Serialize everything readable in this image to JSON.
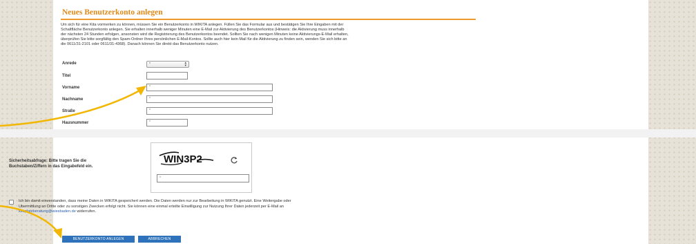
{
  "form": {
    "title": "Neues Benutzerkonto anlegen",
    "intro_lines": [
      "Um sich für eine Kita vormerken zu können, müssen Sie ein Benutzerkonto in WIKITA anlegen. Füllen Sie das Formular aus und bestätigen Sie Ihre Eingaben mit der",
      "Schaltfläche Benutzerkonto anlegen. Sie erhalten innerhalb weniger Minuten eine E-Mail zur Aktivierung des Benutzerkontos (Hinweis: die Aktivierung muss innerhalb",
      "der nächsten 24 Stunden erfolgen, ansonsten wird die Registrierung des Benutzerkontos beendet. Sollten Sie nach wenigen Minuten keine Aktivierungs-E-Mail erhalten,",
      "überprüfen Sie bitte sorgfältig den Spam-Ordner Ihres persönlichen E-Mail-Kontos. Sollte auch hier kein Mail für die Aktivierung zu finden sein, wenden Sie sich bitte an",
      "die 0611/31-2101 oder 0611/31-4368). Danach können Sie direkt das Benutzerkonto nutzen."
    ],
    "fields": {
      "anrede": {
        "label": "Anrede",
        "value": "*"
      },
      "titel": {
        "label": "Titel",
        "value": ""
      },
      "vorname": {
        "label": "Vorname",
        "value": "*"
      },
      "nachname": {
        "label": "Nachname",
        "value": "*"
      },
      "strasse": {
        "label": "Straße",
        "value": "*"
      },
      "hausnummer": {
        "label": "Hausnummer",
        "value": "*"
      }
    }
  },
  "captcha": {
    "label": "Sicherheitsabfrage: Bitte tragen Sie die Buchstaben/Ziffern in das Eingabefeld ein.",
    "code": "WIN3P2",
    "input_value": "*",
    "reload_icon": "reload-icon"
  },
  "consent": {
    "line1": "Ich bin damit einverstanden, dass meine Daten in WIKITA gespeichert werden. Die Daten werden nur zur Bearbeitung in WIKITA genutzt. Eine Weitergabe oder",
    "line2": "Übermittlung an Dritte oder zu sonstigen Zwecken erfolgt nicht. Sie können eine einmal erteilte Einwilligung zur Nutzung Ihrer Daten jederzeit per E-Mail an",
    "email": "kitaplatzberatung@wiesbaden.de",
    "tail": " widerrufen."
  },
  "buttons": {
    "create": "BENUTZERKONTO ANLEGEN",
    "cancel": "ABBRECHEN"
  },
  "colors": {
    "title": "#e08a1a",
    "rule": "#ee9a2a",
    "button": "#2d72ba",
    "arrow": "#f2b705",
    "link": "#2a5fb0"
  }
}
